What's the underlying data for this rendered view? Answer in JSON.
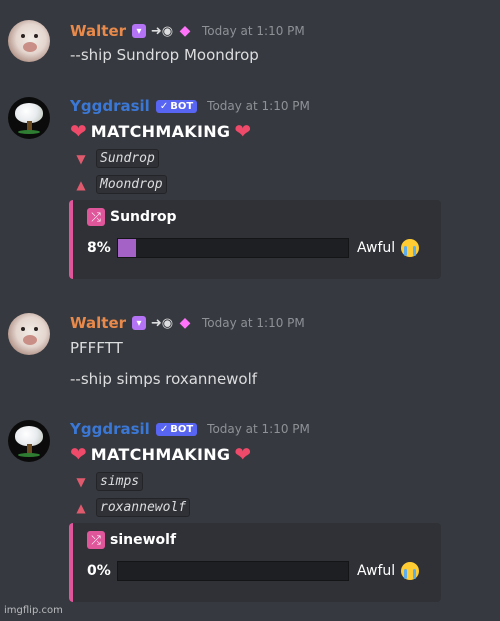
{
  "messages": [
    {
      "author": "Walter",
      "timestamp": "Today at 1:10 PM",
      "lines": [
        "--ship Sundrop Moondrop"
      ]
    },
    {
      "author": "Yggdrasil",
      "bot_badge": "BOT",
      "timestamp": "Today at 1:10 PM",
      "title": "MATCHMAKING",
      "down_name": "Sundrop",
      "up_name": "Moondrop",
      "embed": {
        "name": "Sundrop",
        "percent_label": "8%",
        "percent": 8,
        "verdict": "Awful"
      }
    },
    {
      "author": "Walter",
      "timestamp": "Today at 1:10 PM",
      "lines": [
        "PFFFTT",
        "--ship simps roxannewolf"
      ]
    },
    {
      "author": "Yggdrasil",
      "bot_badge": "BOT",
      "timestamp": "Today at 1:10 PM",
      "title": "MATCHMAKING",
      "down_name": "simps",
      "up_name": "roxannewolf",
      "embed": {
        "name": "sinewolf",
        "percent_label": "0%",
        "percent": 0,
        "verdict": "Awful"
      }
    }
  ],
  "watermark": "imgflip.com",
  "colors": {
    "walter_name": "#e98a4b",
    "bot_name": "#3b78d6",
    "embed_accent": "#e0569b",
    "background": "#36393f"
  },
  "icons": {
    "walter_badges": [
      "nitro-icon",
      "boost-icon",
      "gem-icon"
    ],
    "heart": "heart-icon",
    "down": "triangle-down-icon",
    "up": "triangle-up-icon",
    "shuffle": "shuffle-icon",
    "verdict_emoji": "sob-emoji"
  }
}
